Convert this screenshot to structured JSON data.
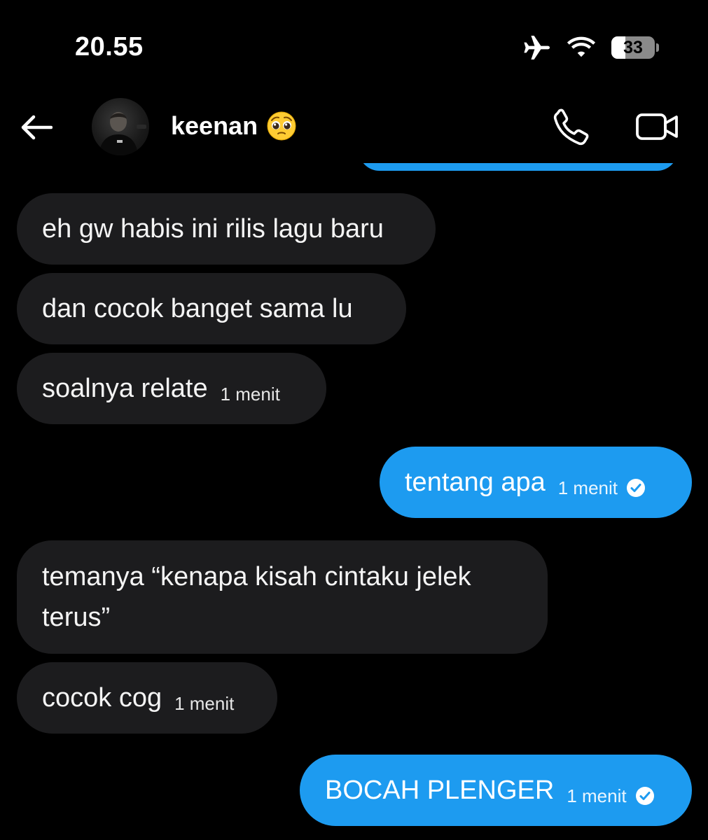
{
  "status_bar": {
    "time": "20.55",
    "battery": "33",
    "battery_fraction": 0.33,
    "icons": [
      "airplane-icon",
      "wifi-icon",
      "battery-icon"
    ]
  },
  "header": {
    "contact_name": "keenan",
    "name_emoji": "pleading-face-emoji",
    "actions": [
      "phone-icon",
      "video-camera-icon"
    ]
  },
  "messages": [
    {
      "direction": "in",
      "text": "eh gw habis ini rilis lagu baru",
      "time": ""
    },
    {
      "direction": "in",
      "text": "dan cocok banget sama lu",
      "time": ""
    },
    {
      "direction": "in",
      "text": "soalnya relate",
      "time": "1 menit"
    },
    {
      "direction": "out",
      "text": "tentang apa",
      "time": "1 menit",
      "read": true
    },
    {
      "direction": "in",
      "text": "temanya “kenapa kisah cintaku jelek terus”",
      "time": ""
    },
    {
      "direction": "in",
      "text": "cocok cog",
      "time": "1 menit"
    },
    {
      "direction": "out",
      "text": "BOCAH PLENGER",
      "time": "1 menit",
      "read": true
    }
  ],
  "colors": {
    "background": "#000000",
    "incoming_bubble": "#1c1c1e",
    "outgoing_bubble": "#1d9bf0",
    "text": "#ffffff"
  }
}
